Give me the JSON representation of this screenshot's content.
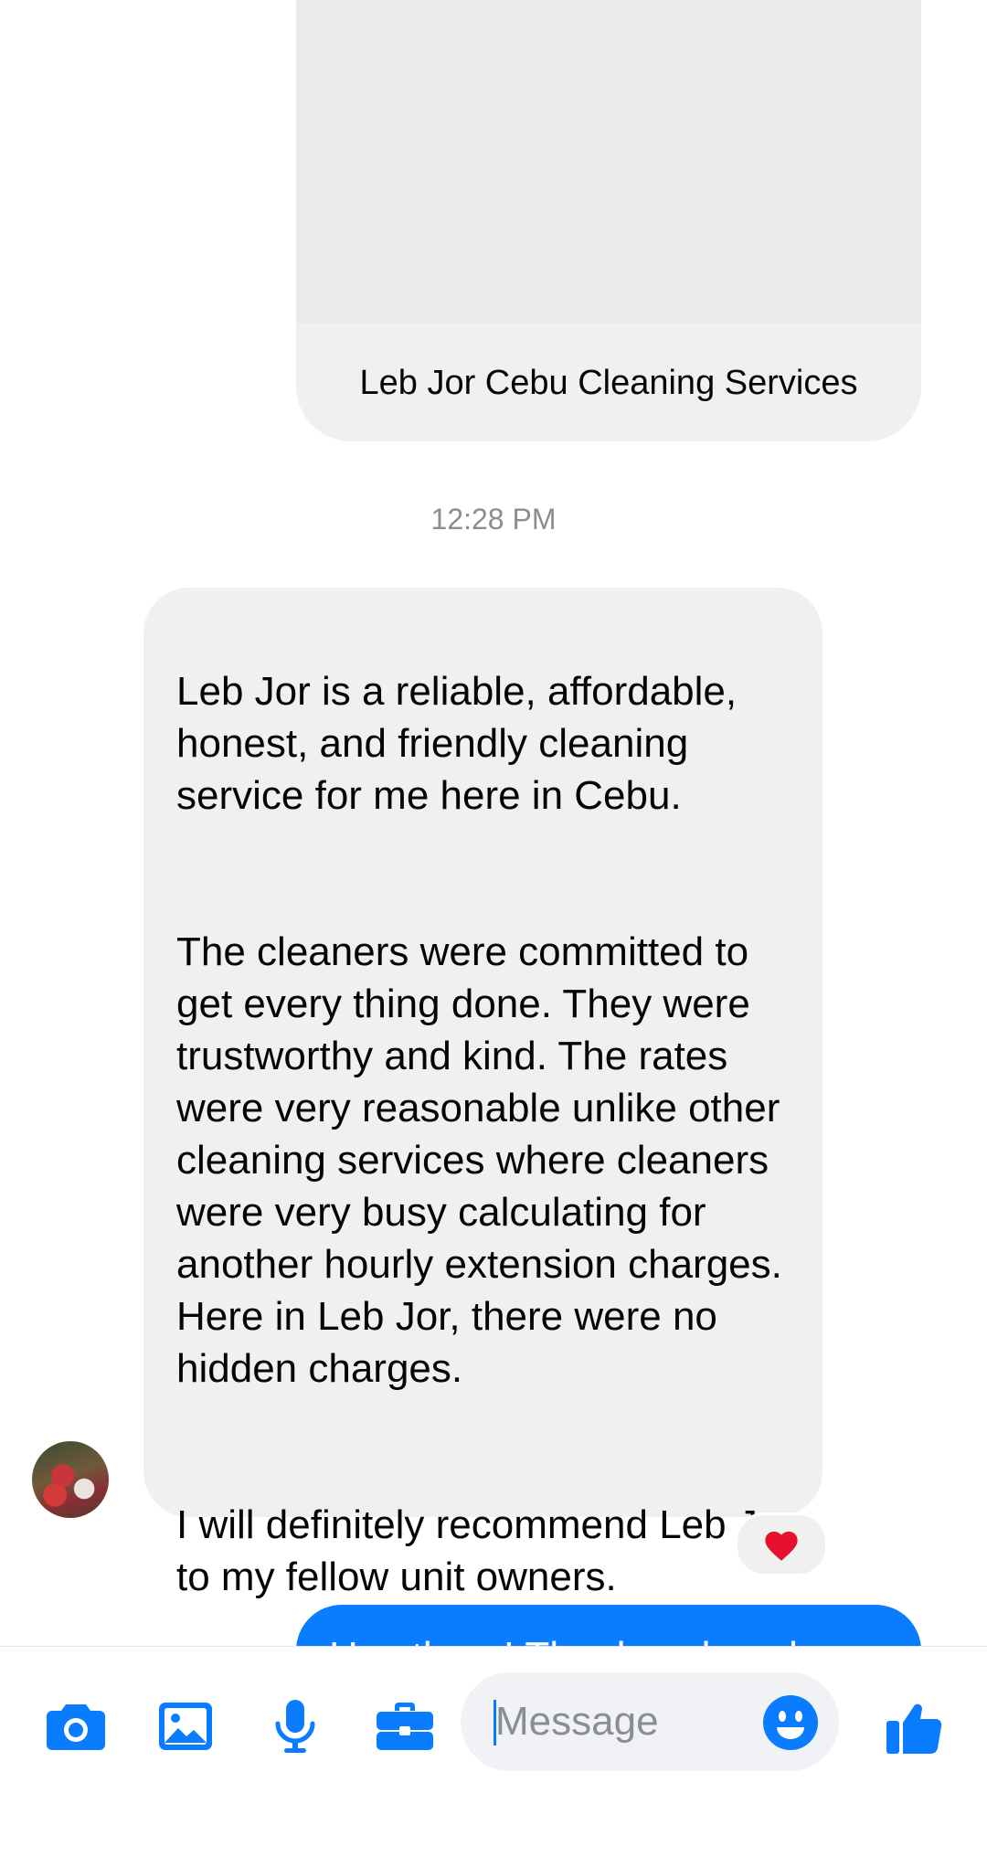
{
  "shared_card": {
    "title": "Leb Jor Cebu Cleaning Services"
  },
  "timestamp": "12:28 PM",
  "incoming_message": {
    "paragraphs": [
      "Leb Jor is a reliable, affordable, honest, and friendly cleaning service for me here in Cebu.",
      "The cleaners were committed to get every thing done. They were trustworthy and kind.  The rates were very reasonable unlike other cleaning services where cleaners were very busy calculating for another hourly extension charges. Here in Leb Jor, there were no hidden charges.",
      "I will definitely recommend Leb Jor to my fellow unit owners."
    ],
    "reaction": "❤️"
  },
  "outgoing_message": {
    "text": "Hey there! Thanks a bunch"
  },
  "composer": {
    "placeholder": "Message",
    "icons": [
      "camera-icon",
      "image-icon",
      "microphone-icon",
      "briefcase-icon",
      "emoji-icon",
      "thumbs-up-icon"
    ],
    "accent_color": "#0a7cff"
  }
}
